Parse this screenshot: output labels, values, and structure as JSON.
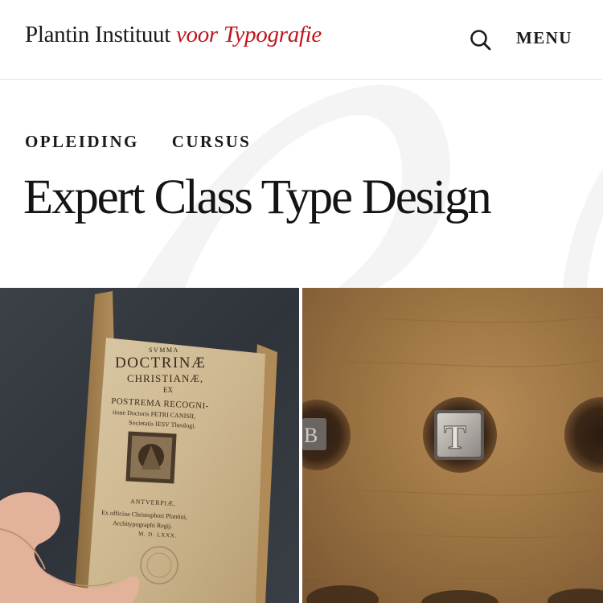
{
  "header": {
    "logo_main": "Plantin Instituut",
    "logo_accent": "voor Typografie",
    "menu_label": "MENU",
    "search_icon": "search-icon"
  },
  "hero": {
    "categories": [
      "OPLEIDING",
      "CURSUS"
    ],
    "title": "Expert Class Type Design"
  },
  "images": {
    "book_page_text": [
      "SVMMA",
      "DOCTRINÆ",
      "CHRISTIANÆ,",
      "EX",
      "POSTREMA RECOGNI-",
      "tione Doctoris PETRI CANISII,",
      "Societatis IESV Theologi.",
      "ANTVERPIÆ,",
      "Ex officina Christophori Plantini,",
      "Architypographi Regij.",
      "M. D. LXXX."
    ],
    "type_letters": [
      "B",
      "T"
    ]
  }
}
